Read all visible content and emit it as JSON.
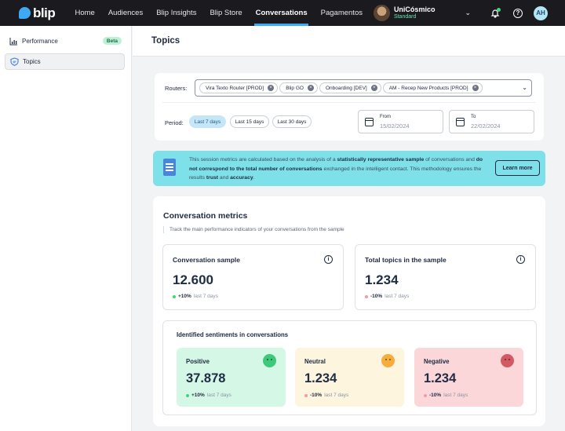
{
  "nav": {
    "logo": "blip",
    "links": [
      "Home",
      "Audiences",
      "Blip Insights",
      "Blip Store",
      "Conversations",
      "Pagamentos"
    ],
    "active": "Conversations",
    "user_name": "UniCósmico",
    "user_role": "Standard",
    "initials": "AH"
  },
  "sidebar": {
    "items": [
      {
        "label": "Performance",
        "badge": "Beta",
        "icon": "chart-icon"
      },
      {
        "label": "Topics",
        "icon": "shield-chat-icon"
      }
    ]
  },
  "page": {
    "title": "Topics"
  },
  "filters": {
    "routers_label": "Routers:",
    "routers": [
      "Vira Texto Router [PROD]",
      "Blip GO",
      "Onboarding [DEV]",
      "AM - Recep New Products [PROD]"
    ],
    "period_label": "Period:",
    "periods": [
      "Last 7 days",
      "Last 15 days",
      "Last 30 days"
    ],
    "active_period": "Last 7 days",
    "from_label": "From",
    "from_value": "15/02/2024",
    "to_label": "To",
    "to_value": "22/02/2024"
  },
  "banner": {
    "p1": "This session metrics are calculated based on the analysis of a ",
    "b1": "statistically representative sample",
    "p2": " of conversations and ",
    "b2": "do not correspond to the total number of conversations",
    "p3": " exchanged in the intelligent contact. This methodology ensures the results ",
    "b3": "trust",
    "p4": " and ",
    "b4": "accuracy",
    "p5": ".",
    "button": "Learn more"
  },
  "metrics": {
    "title": "Conversation metrics",
    "subtitle": "Track the main performance indicators of your conversations from the sample",
    "kpis": [
      {
        "title": "Conversation sample",
        "value": "12.600",
        "delta": "+10%",
        "period": "last 7 days",
        "color": "#3ed67f"
      },
      {
        "title": "Total topics in the sample",
        "value": "1.234",
        "delta": "-10%",
        "period": "last 7 days",
        "color": "#f39aa6"
      }
    ],
    "sentiments_title": "Identified sentiments in conversations",
    "sentiments": [
      {
        "label": "Positive",
        "value": "37.878",
        "delta": "+10%",
        "period": "last 7 days",
        "bg": "#d5f7e6",
        "face": "#3dc97a",
        "dot": "#3ed67f"
      },
      {
        "label": "Neutral",
        "value": "1.234",
        "delta": "-10%",
        "period": "last 7 days",
        "bg": "#fdf5de",
        "face": "#f5ad3c",
        "dot": "#f39aa6"
      },
      {
        "label": "Negative",
        "value": "1.234",
        "delta": "-10%",
        "period": "last 7 days",
        "bg": "#fbd7d9",
        "face": "#d35a62",
        "dot": "#f39aa6"
      }
    ]
  }
}
